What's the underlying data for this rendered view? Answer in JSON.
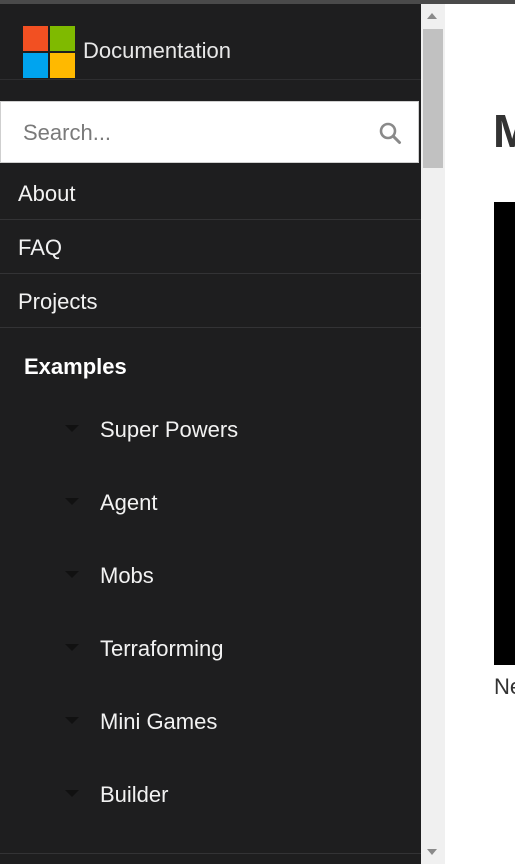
{
  "brand": {
    "title": "Documentation"
  },
  "search": {
    "placeholder": "Search..."
  },
  "nav": {
    "items": [
      {
        "label": "About"
      },
      {
        "label": "FAQ"
      },
      {
        "label": "Projects"
      }
    ]
  },
  "examples": {
    "heading": "Examples",
    "items": [
      {
        "label": "Super Powers"
      },
      {
        "label": "Agent"
      },
      {
        "label": "Mobs"
      },
      {
        "label": "Terraforming"
      },
      {
        "label": "Mini Games"
      },
      {
        "label": "Builder"
      }
    ]
  },
  "main": {
    "heading_partial": "M",
    "caption_partial": "Ne"
  },
  "colors": {
    "sidebar_bg": "#1e1e1f",
    "logo_red": "#f25022",
    "logo_green": "#7fba00",
    "logo_blue": "#00a4ef",
    "logo_yellow": "#ffb900"
  }
}
